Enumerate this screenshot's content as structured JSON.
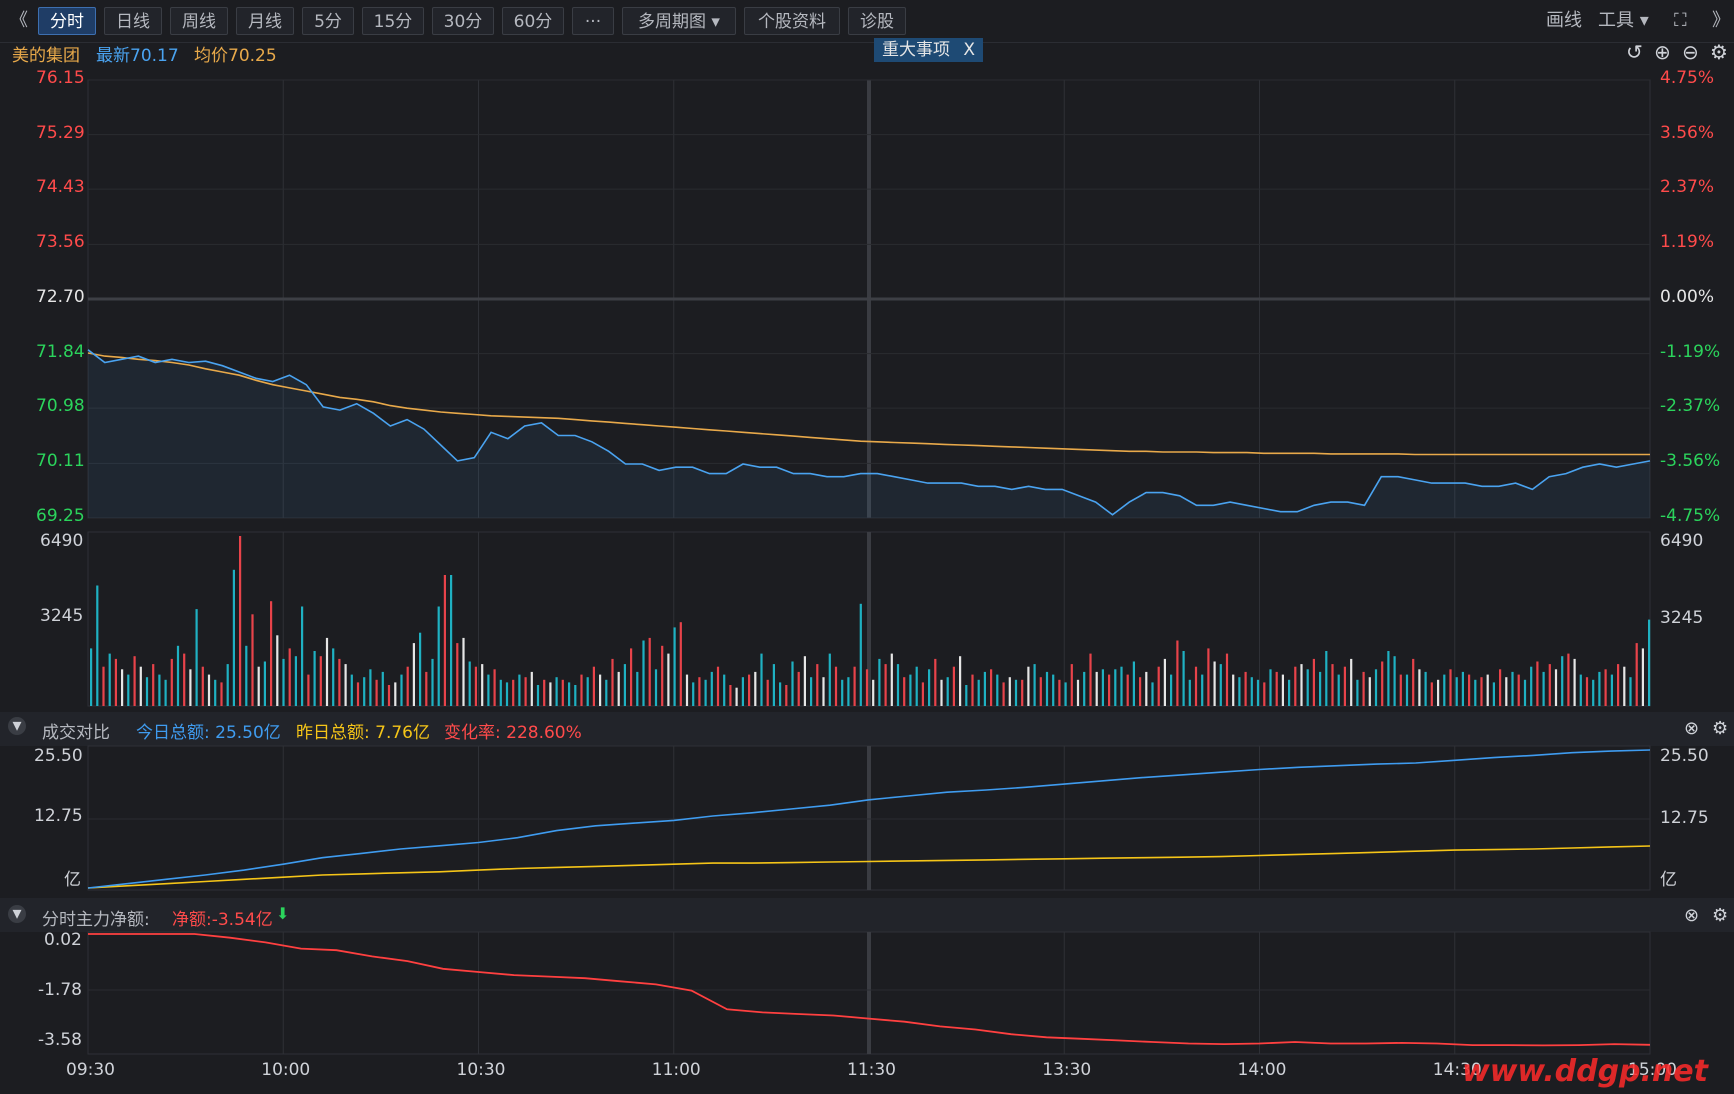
{
  "toolbar": {
    "back": "《",
    "tabs": [
      {
        "label": "分时",
        "active": true
      },
      {
        "label": "日线"
      },
      {
        "label": "周线"
      },
      {
        "label": "月线"
      },
      {
        "label": "5分"
      },
      {
        "label": "15分"
      },
      {
        "label": "30分"
      },
      {
        "label": "60分"
      },
      {
        "label": "···"
      },
      {
        "label": "多周期图 ▾"
      },
      {
        "label": "个股资料"
      },
      {
        "label": "诊股"
      }
    ],
    "draw": "画线",
    "tools": "工具 ▾",
    "expand": "⛶",
    "forward": "》"
  },
  "info": {
    "stock_name": "美的集团",
    "latest": "最新70.17",
    "avg": "均价70.25",
    "event_tag": "重大事项",
    "event_close": "X"
  },
  "icons": [
    "undo-icon",
    "zoom-in-icon",
    "zoom-out-icon",
    "gear-icon"
  ],
  "price_axis": {
    "left": [
      "76.15",
      "75.29",
      "74.43",
      "73.56",
      "72.70",
      "71.84",
      "70.98",
      "70.11",
      "69.25"
    ],
    "right": [
      "4.75%",
      "3.56%",
      "2.37%",
      "1.19%",
      "0.00%",
      "-1.19%",
      "-2.37%",
      "-3.56%",
      "-4.75%"
    ]
  },
  "volume_axis": {
    "left": [
      "6490",
      "3245"
    ],
    "right": [
      "6490",
      "3245"
    ]
  },
  "turnover_panel": {
    "toggle": "▾",
    "title": "成交对比",
    "today": "今日总额: 25.50亿",
    "yesterday": "昨日总额: 7.76亿",
    "change": "变化率: 228.60%",
    "left_axis": [
      "25.50",
      "12.75",
      "亿"
    ],
    "right_axis": [
      "25.50",
      "12.75",
      "亿"
    ]
  },
  "flow_panel": {
    "toggle": "▾",
    "title": "分时主力净额:",
    "net": "净额:-3.54亿",
    "arrow": "⬇",
    "left_axis": [
      "0.02",
      "-1.78",
      "-3.58"
    ]
  },
  "time_axis": [
    "09:30",
    "10:00",
    "10:30",
    "11:00",
    "11:30",
    "13:30",
    "14:00",
    "14:30",
    "15:00"
  ],
  "watermark": "www.ddgp.net",
  "colors": {
    "price_line": "#4aa3f0",
    "avg_line": "#e8a94a",
    "up": "#ff4b4b",
    "down": "#2bd45c",
    "cyan_bar": "#1fb1c2",
    "red_bar": "#e8434a",
    "white_bar": "#e6e6e6",
    "today_line": "#3f9cf0",
    "yesterday_line": "#f5c518",
    "flow_line": "#ff4040"
  },
  "chart_data": [
    {
      "type": "line",
      "title": "",
      "ylim": [
        69.25,
        76.15
      ],
      "x_labels": [
        "09:30",
        "10:00",
        "10:30",
        "11:00",
        "11:30",
        "13:30",
        "14:00",
        "14:30",
        "15:00"
      ],
      "series": [
        {
          "name": "最新",
          "values": [
            71.9,
            71.7,
            71.75,
            71.8,
            71.7,
            71.75,
            71.7,
            71.72,
            71.65,
            71.55,
            71.45,
            71.4,
            71.5,
            71.35,
            71.0,
            70.95,
            71.05,
            70.9,
            70.7,
            70.8,
            70.65,
            70.4,
            70.15,
            70.2,
            70.6,
            70.5,
            70.7,
            70.75,
            70.55,
            70.55,
            70.45,
            70.3,
            70.1,
            70.1,
            70.0,
            70.05,
            70.05,
            69.95,
            69.95,
            70.1,
            70.05,
            70.05,
            69.95,
            69.95,
            69.9,
            69.9,
            69.95,
            69.95,
            69.9,
            69.85,
            69.8,
            69.8,
            69.8,
            69.75,
            69.75,
            69.7,
            69.75,
            69.7,
            69.7,
            69.6,
            69.5,
            69.3,
            69.5,
            69.65,
            69.65,
            69.6,
            69.45,
            69.45,
            69.5,
            69.45,
            69.4,
            69.35,
            69.35,
            69.45,
            69.5,
            69.5,
            69.45,
            69.9,
            69.9,
            69.85,
            69.8,
            69.8,
            69.8,
            69.75,
            69.75,
            69.8,
            69.7,
            69.9,
            69.95,
            70.05,
            70.1,
            70.05,
            70.1,
            70.15
          ]
        },
        {
          "name": "均价",
          "values": [
            71.85,
            71.8,
            71.78,
            71.75,
            71.73,
            71.7,
            71.66,
            71.6,
            71.55,
            71.5,
            71.42,
            71.35,
            71.3,
            71.25,
            71.2,
            71.15,
            71.12,
            71.08,
            71.02,
            70.98,
            70.95,
            70.92,
            70.9,
            70.88,
            70.86,
            70.85,
            70.84,
            70.83,
            70.82,
            70.8,
            70.78,
            70.76,
            70.74,
            70.72,
            70.7,
            70.68,
            70.66,
            70.64,
            70.62,
            70.6,
            70.58,
            70.56,
            70.54,
            70.52,
            70.5,
            70.48,
            70.46,
            70.45,
            70.44,
            70.43,
            70.42,
            70.41,
            70.4,
            70.39,
            70.38,
            70.37,
            70.36,
            70.35,
            70.34,
            70.33,
            70.32,
            70.31,
            70.3,
            70.3,
            70.29,
            70.29,
            70.29,
            70.28,
            70.28,
            70.28,
            70.27,
            70.27,
            70.27,
            70.27,
            70.26,
            70.26,
            70.26,
            70.26,
            70.26,
            70.25,
            70.25,
            70.25,
            70.25,
            70.25,
            70.25,
            70.25,
            70.25,
            70.25,
            70.25,
            70.25,
            70.25,
            70.25,
            70.25,
            70.25
          ]
        }
      ]
    },
    {
      "type": "bar",
      "title": "",
      "ylim": [
        0,
        6490
      ],
      "note_values": "per-minute volume",
      "values": [
        2200,
        4600,
        1500,
        2000,
        1800,
        1400,
        1200,
        1900,
        1500,
        1100,
        1600,
        1200,
        1000,
        1800,
        2300,
        2000,
        1400,
        3700,
        1500,
        1200,
        1000,
        900,
        1600,
        5200,
        6490,
        2300,
        3500,
        1500,
        1700,
        4000,
        2700,
        1800,
        2200,
        1900,
        3800,
        1200,
        2100,
        1900,
        2600,
        2200,
        1800,
        1600,
        1200,
        900,
        1100,
        1400,
        1000,
        1300,
        800,
        900,
        1200,
        1500,
        2400,
        2800,
        1300,
        1800,
        3800,
        5000,
        5000,
        2400,
        2600,
        1700,
        1500,
        1600,
        1200,
        1400,
        1000,
        900,
        1000,
        1200,
        1100,
        1300,
        800,
        1000,
        900,
        1100,
        1000,
        900,
        800,
        1200,
        1100,
        1500,
        1200,
        1000,
        1800,
        1300,
        1600,
        2200,
        1300,
        2500,
        2600,
        1400,
        2300,
        2000,
        3000,
        3200,
        1200,
        900,
        1100,
        1000,
        1300,
        1500,
        1200,
        800,
        700,
        1100,
        1200,
        1300,
        2000,
        1000,
        1600,
        900,
        800,
        1700,
        1300,
        1900,
        1100,
        1600,
        1100,
        2000,
        1500,
        1000,
        1100,
        1500,
        3900,
        1400,
        1000,
        1800,
        1600,
        2000,
        1600,
        1100,
        1200,
        1500,
        900,
        1400,
        1800,
        1000,
        1100,
        1500,
        1900,
        800,
        1200,
        1000,
        1300,
        1400,
        1200,
        900,
        1100,
        1000,
        1000,
        1500,
        1600,
        1100,
        1300,
        1200,
        1000,
        900,
        1600,
        1000,
        1300,
        2000,
        1300,
        1400,
        1200,
        1400,
        1500,
        1200,
        1700,
        1100,
        1300,
        900,
        1500,
        1800,
        1200,
        2500,
        2100,
        1000,
        1500,
        1200,
        2200,
        1700,
        1600,
        2000,
        1200,
        1100,
        1300,
        1100,
        1000,
        900,
        1400,
        1300,
        1200,
        1000,
        1500,
        1600,
        1400,
        1800,
        1300,
        2100,
        1600,
        1200,
        1500,
        1800,
        1000,
        1300,
        1100,
        1400,
        1700,
        2100,
        1900,
        1200,
        1200,
        1800,
        1400,
        1300,
        900,
        1000,
        1200,
        1400,
        1100,
        1300,
        1200,
        1000,
        1100,
        1200,
        900,
        1400,
        1100,
        1300,
        1200,
        1000,
        1500,
        1700,
        1300,
        1600,
        1400,
        1900,
        2000,
        1800,
        1200,
        1100,
        1000,
        1300,
        1400,
        1200,
        1600,
        1500,
        1100,
        2400,
        2200,
        3300
      ]
    },
    {
      "type": "line",
      "title": "",
      "ylim": [
        0,
        25.5
      ],
      "series": [
        {
          "name": "今日总额",
          "values": [
            0,
            0.8,
            1.6,
            2.4,
            3.3,
            4.4,
            5.6,
            6.4,
            7.2,
            7.8,
            8.4,
            9.3,
            10.6,
            11.5,
            12.0,
            12.5,
            13.3,
            13.9,
            14.6,
            15.3,
            16.3,
            17.0,
            17.7,
            18.1,
            18.6,
            19.2,
            19.8,
            20.4,
            20.9,
            21.4,
            21.9,
            22.3,
            22.6,
            22.9,
            23.1,
            23.6,
            24.1,
            24.5,
            25.0,
            25.3,
            25.5
          ]
        },
        {
          "name": "昨日总额",
          "values": [
            0,
            0.4,
            0.8,
            1.2,
            1.6,
            2.0,
            2.4,
            2.6,
            2.8,
            3.0,
            3.3,
            3.6,
            3.8,
            4.0,
            4.2,
            4.4,
            4.6,
            4.6,
            4.7,
            4.8,
            4.9,
            5.0,
            5.1,
            5.2,
            5.3,
            5.4,
            5.5,
            5.6,
            5.7,
            5.8,
            6.0,
            6.2,
            6.4,
            6.6,
            6.8,
            7.0,
            7.1,
            7.2,
            7.4,
            7.6,
            7.76
          ]
        }
      ]
    },
    {
      "type": "line",
      "title": "",
      "ylim": [
        -3.58,
        0.02
      ],
      "series": [
        {
          "name": "净额",
          "values": [
            0.02,
            0.02,
            0.02,
            0.02,
            -0.1,
            -0.25,
            -0.45,
            -0.5,
            -0.7,
            -0.85,
            -1.1,
            -1.2,
            -1.3,
            -1.35,
            -1.4,
            -1.5,
            -1.6,
            -1.8,
            -2.4,
            -2.5,
            -2.55,
            -2.6,
            -2.7,
            -2.8,
            -2.95,
            -3.05,
            -3.2,
            -3.3,
            -3.35,
            -3.4,
            -3.45,
            -3.5,
            -3.52,
            -3.5,
            -3.45,
            -3.5,
            -3.5,
            -3.48,
            -3.5,
            -3.55,
            -3.55,
            -3.56,
            -3.55,
            -3.52,
            -3.54
          ]
        }
      ]
    }
  ]
}
